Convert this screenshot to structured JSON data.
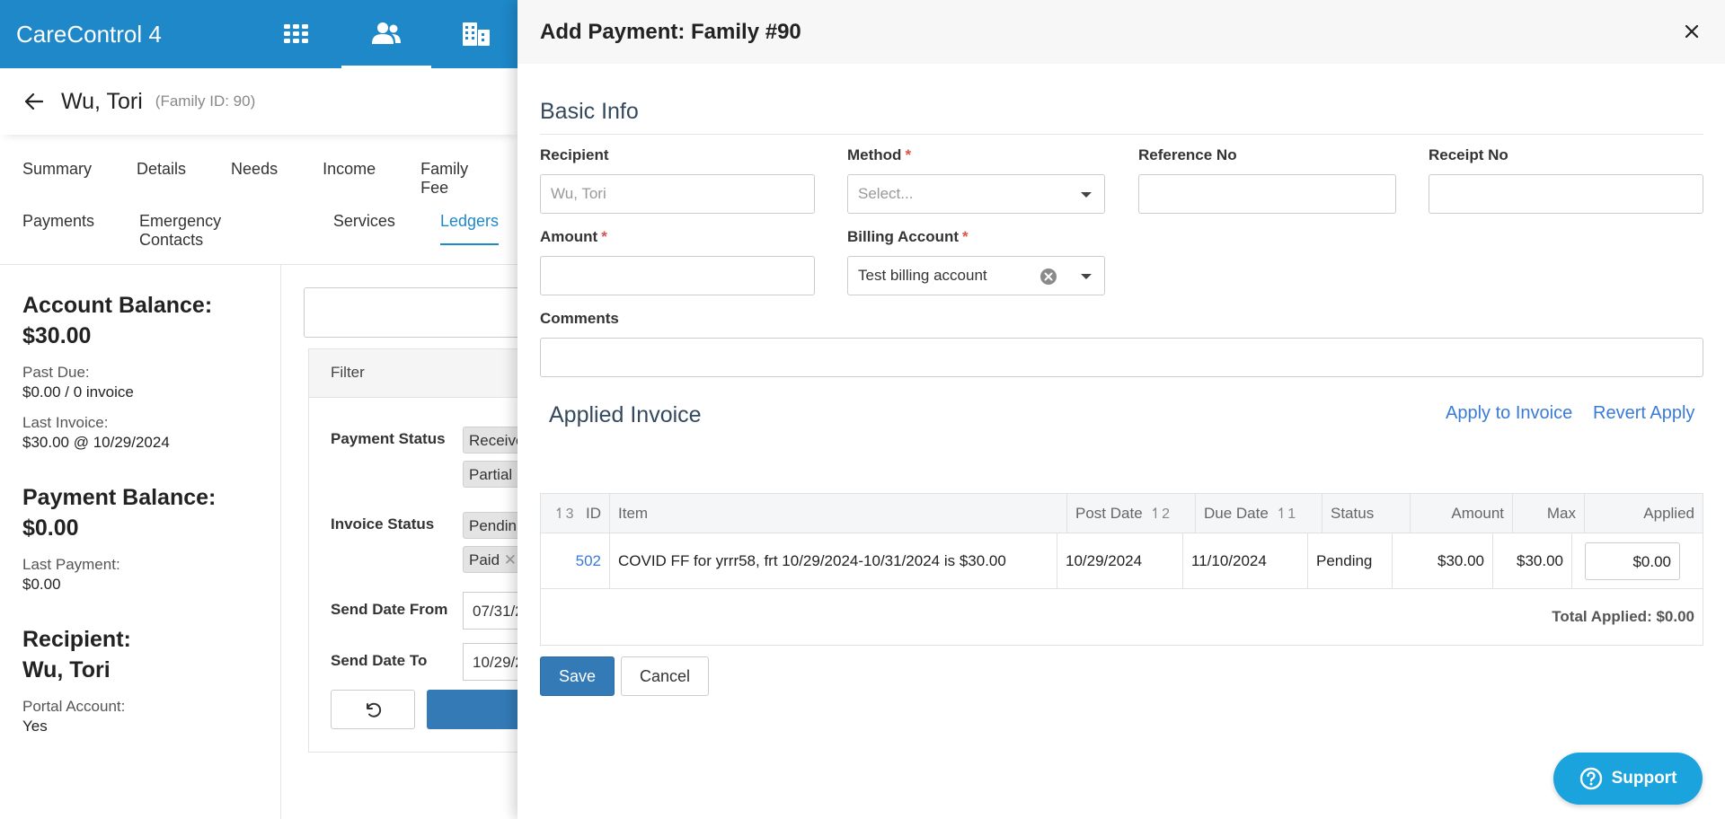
{
  "app": {
    "brand": "CareControl 4"
  },
  "topnav": [
    {
      "name": "apps-grid-icon"
    },
    {
      "name": "families-icon"
    },
    {
      "name": "facilities-icon"
    }
  ],
  "family": {
    "name": "Wu, Tori",
    "id_text": "(Family ID: 90)"
  },
  "tabs": {
    "row1": [
      "Summary",
      "Details",
      "Needs",
      "Income",
      "Family Fee"
    ],
    "row2": [
      "Payments",
      "Emergency Contacts",
      "Services",
      "Ledgers"
    ],
    "active": "Ledgers"
  },
  "sidebar": {
    "account_balance_title": "Account Balance:",
    "account_balance_value": "$30.00",
    "past_due_label": "Past Due:",
    "past_due_value": "$0.00 / 0 invoice",
    "last_invoice_label": "Last Invoice:",
    "last_invoice_value": "$30.00 @ 10/29/2024",
    "payment_balance_title": "Payment Balance:",
    "payment_balance_value": "$0.00",
    "last_payment_label": "Last Payment:",
    "last_payment_value": "$0.00",
    "recipient_title": "Recipient:",
    "recipient_value": "Wu, Tori",
    "portal_label": "Portal Account:",
    "portal_value": "Yes"
  },
  "filter": {
    "heading": "Filter",
    "payment_status_label": "Payment Status",
    "payment_status_chips": [
      "Receive",
      "Partial"
    ],
    "invoice_status_label": "Invoice Status",
    "invoice_status_chips": [
      "Pendin",
      "Paid"
    ],
    "send_date_from_label": "Send Date From",
    "send_date_from_value": "07/31/2",
    "send_date_to_label": "Send Date To",
    "send_date_to_value": "10/29/2"
  },
  "modal": {
    "title": "Add Payment: Family #90",
    "section_basic": "Basic Info",
    "recipient_label": "Recipient",
    "recipient_value": "Wu, Tori",
    "method_label": "Method",
    "method_placeholder": "Select...",
    "reference_label": "Reference No",
    "receipt_label": "Receipt No",
    "amount_label": "Amount",
    "billing_label": "Billing Account",
    "billing_value": "Test billing account",
    "comments_label": "Comments",
    "required_mark": "*",
    "section_applied": "Applied Invoice",
    "apply_link": "Apply to Invoice",
    "revert_link": "Revert Apply",
    "columns": {
      "id": "ID",
      "id_sort": "3",
      "item": "Item",
      "post_date": "Post Date",
      "post_sort": "2",
      "due_date": "Due Date",
      "due_sort": "1",
      "status": "Status",
      "amount": "Amount",
      "max": "Max",
      "applied": "Applied"
    },
    "rows": [
      {
        "id": "502",
        "item": "COVID FF for yrrr58, frt 10/29/2024-10/31/2024 is $30.00",
        "post_date": "10/29/2024",
        "due_date": "11/10/2024",
        "status": "Pending",
        "amount": "$30.00",
        "max": "$30.00",
        "applied": "$0.00"
      }
    ],
    "total_applied": "Total Applied: $0.00",
    "save_label": "Save",
    "cancel_label": "Cancel"
  },
  "support": {
    "label": "Support"
  },
  "colors": {
    "brand": "#1e88c9",
    "primary_button": "#337ab7",
    "link": "#3a7bd5",
    "support": "#1aa3dd"
  }
}
